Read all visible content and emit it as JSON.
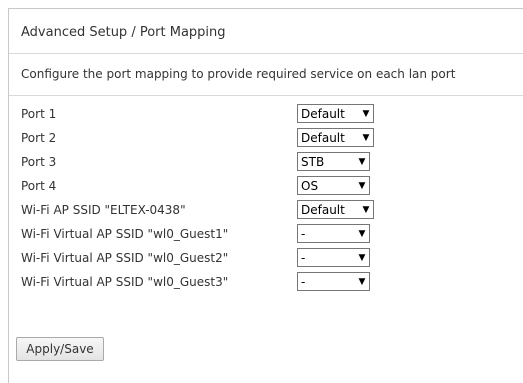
{
  "page": {
    "title": "Advanced Setup / Port Mapping",
    "description": "Configure the port mapping to provide required service on each lan port"
  },
  "mappings": [
    {
      "label": "Port 1",
      "value": "Default"
    },
    {
      "label": "Port 2",
      "value": "Default"
    },
    {
      "label": "Port 3",
      "value": "STB"
    },
    {
      "label": "Port 4",
      "value": "OS"
    },
    {
      "label": "Wi-Fi AP SSID \"ELTEX-0438\"",
      "value": "Default"
    },
    {
      "label": "Wi-Fi Virtual AP SSID \"wl0_Guest1\"",
      "value": "-"
    },
    {
      "label": "Wi-Fi Virtual AP SSID \"wl0_Guest2\"",
      "value": "-"
    },
    {
      "label": "Wi-Fi Virtual AP SSID \"wl0_Guest3\"",
      "value": "-"
    }
  ],
  "actions": {
    "apply_label": "Apply/Save"
  },
  "icons": {
    "dropdown": "triangle-down-icon"
  }
}
